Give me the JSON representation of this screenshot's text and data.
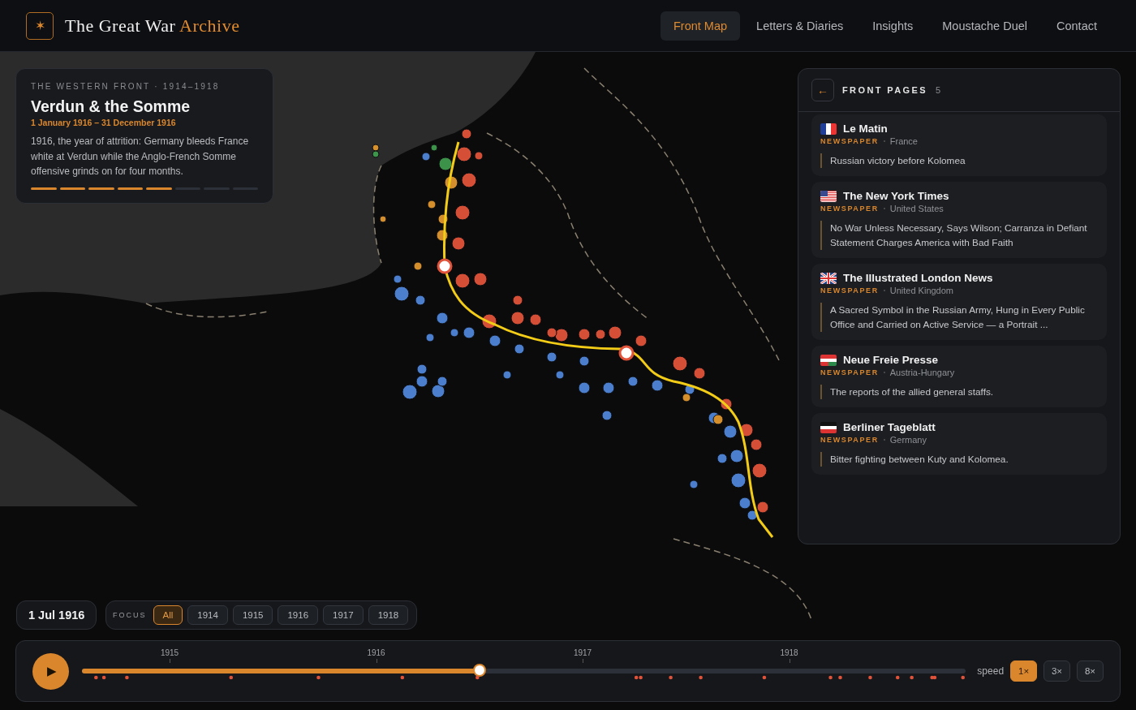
{
  "brand": {
    "title": "The Great War ",
    "accent": "Archive",
    "logo": "✶"
  },
  "nav": [
    {
      "label": "Front Map",
      "selected": true
    },
    {
      "label": "Letters & Diaries",
      "selected": false
    },
    {
      "label": "Insights",
      "selected": false
    },
    {
      "label": "Moustache Duel",
      "selected": false
    },
    {
      "label": "Contact",
      "selected": false
    }
  ],
  "story": {
    "eyebrow": "THE WESTERN FRONT · 1914–1918",
    "title": "Verdun & the Somme",
    "dates": "1 January 1916 – 31 December 1916",
    "body": "1916, the year of attrition: Germany bleeds France white at Verdun while the Anglo-French Somme offensive grinds on for four months.",
    "segments": [
      {
        "filled": true
      },
      {
        "filled": true
      },
      {
        "filled": true
      },
      {
        "filled": true
      },
      {
        "filled": true
      },
      {
        "filled": false
      },
      {
        "filled": false
      },
      {
        "filled": false
      }
    ]
  },
  "front_pages": {
    "back": "←",
    "title": "FRONT PAGES",
    "count": "5",
    "items": [
      {
        "flag": {
          "kind": "france"
        },
        "name": "Le Matin",
        "kind": "NEWSPAPER",
        "country": "France",
        "headline": "Russian victory before Kolomea"
      },
      {
        "flag": {
          "kind": "usa"
        },
        "name": "The New York Times",
        "kind": "NEWSPAPER",
        "country": "United States",
        "headline": "No War Unless Necessary, Says Wilson; Carranza in Defiant Statement Charges America with Bad Faith"
      },
      {
        "flag": {
          "kind": "uk"
        },
        "name": "The Illustrated London News",
        "kind": "NEWSPAPER",
        "country": "United Kingdom",
        "headline": "A Sacred Symbol in the Russian Army, Hung in Every Public Office and Carried on Active Service — a Portrait ..."
      },
      {
        "flag": {
          "kind": "austria"
        },
        "name": "Neue Freie Presse",
        "kind": "NEWSPAPER",
        "country": "Austria-Hungary",
        "headline": "The reports of the allied general staffs."
      },
      {
        "flag": {
          "kind": "germany"
        },
        "name": "Berliner Tageblatt",
        "kind": "NEWSPAPER",
        "country": "Germany",
        "headline": "Bitter fighting between Kuty and Kolomea."
      }
    ]
  },
  "current_date": "1 Jul 1916",
  "focus": {
    "label": "FOCUS",
    "options": [
      {
        "label": "All",
        "selected": true
      },
      {
        "label": "1914",
        "selected": false
      },
      {
        "label": "1915",
        "selected": false
      },
      {
        "label": "1916",
        "selected": false
      },
      {
        "label": "1917",
        "selected": false
      },
      {
        "label": "1918",
        "selected": false
      }
    ]
  },
  "timeline": {
    "play": "▶",
    "years": [
      "1915",
      "1916",
      "1917",
      "1918"
    ],
    "level": 0.45,
    "speed_label": "speed",
    "speeds": [
      {
        "label": "1×",
        "selected": true
      },
      {
        "label": "3×",
        "selected": false
      },
      {
        "label": "8×",
        "selected": false
      }
    ]
  }
}
